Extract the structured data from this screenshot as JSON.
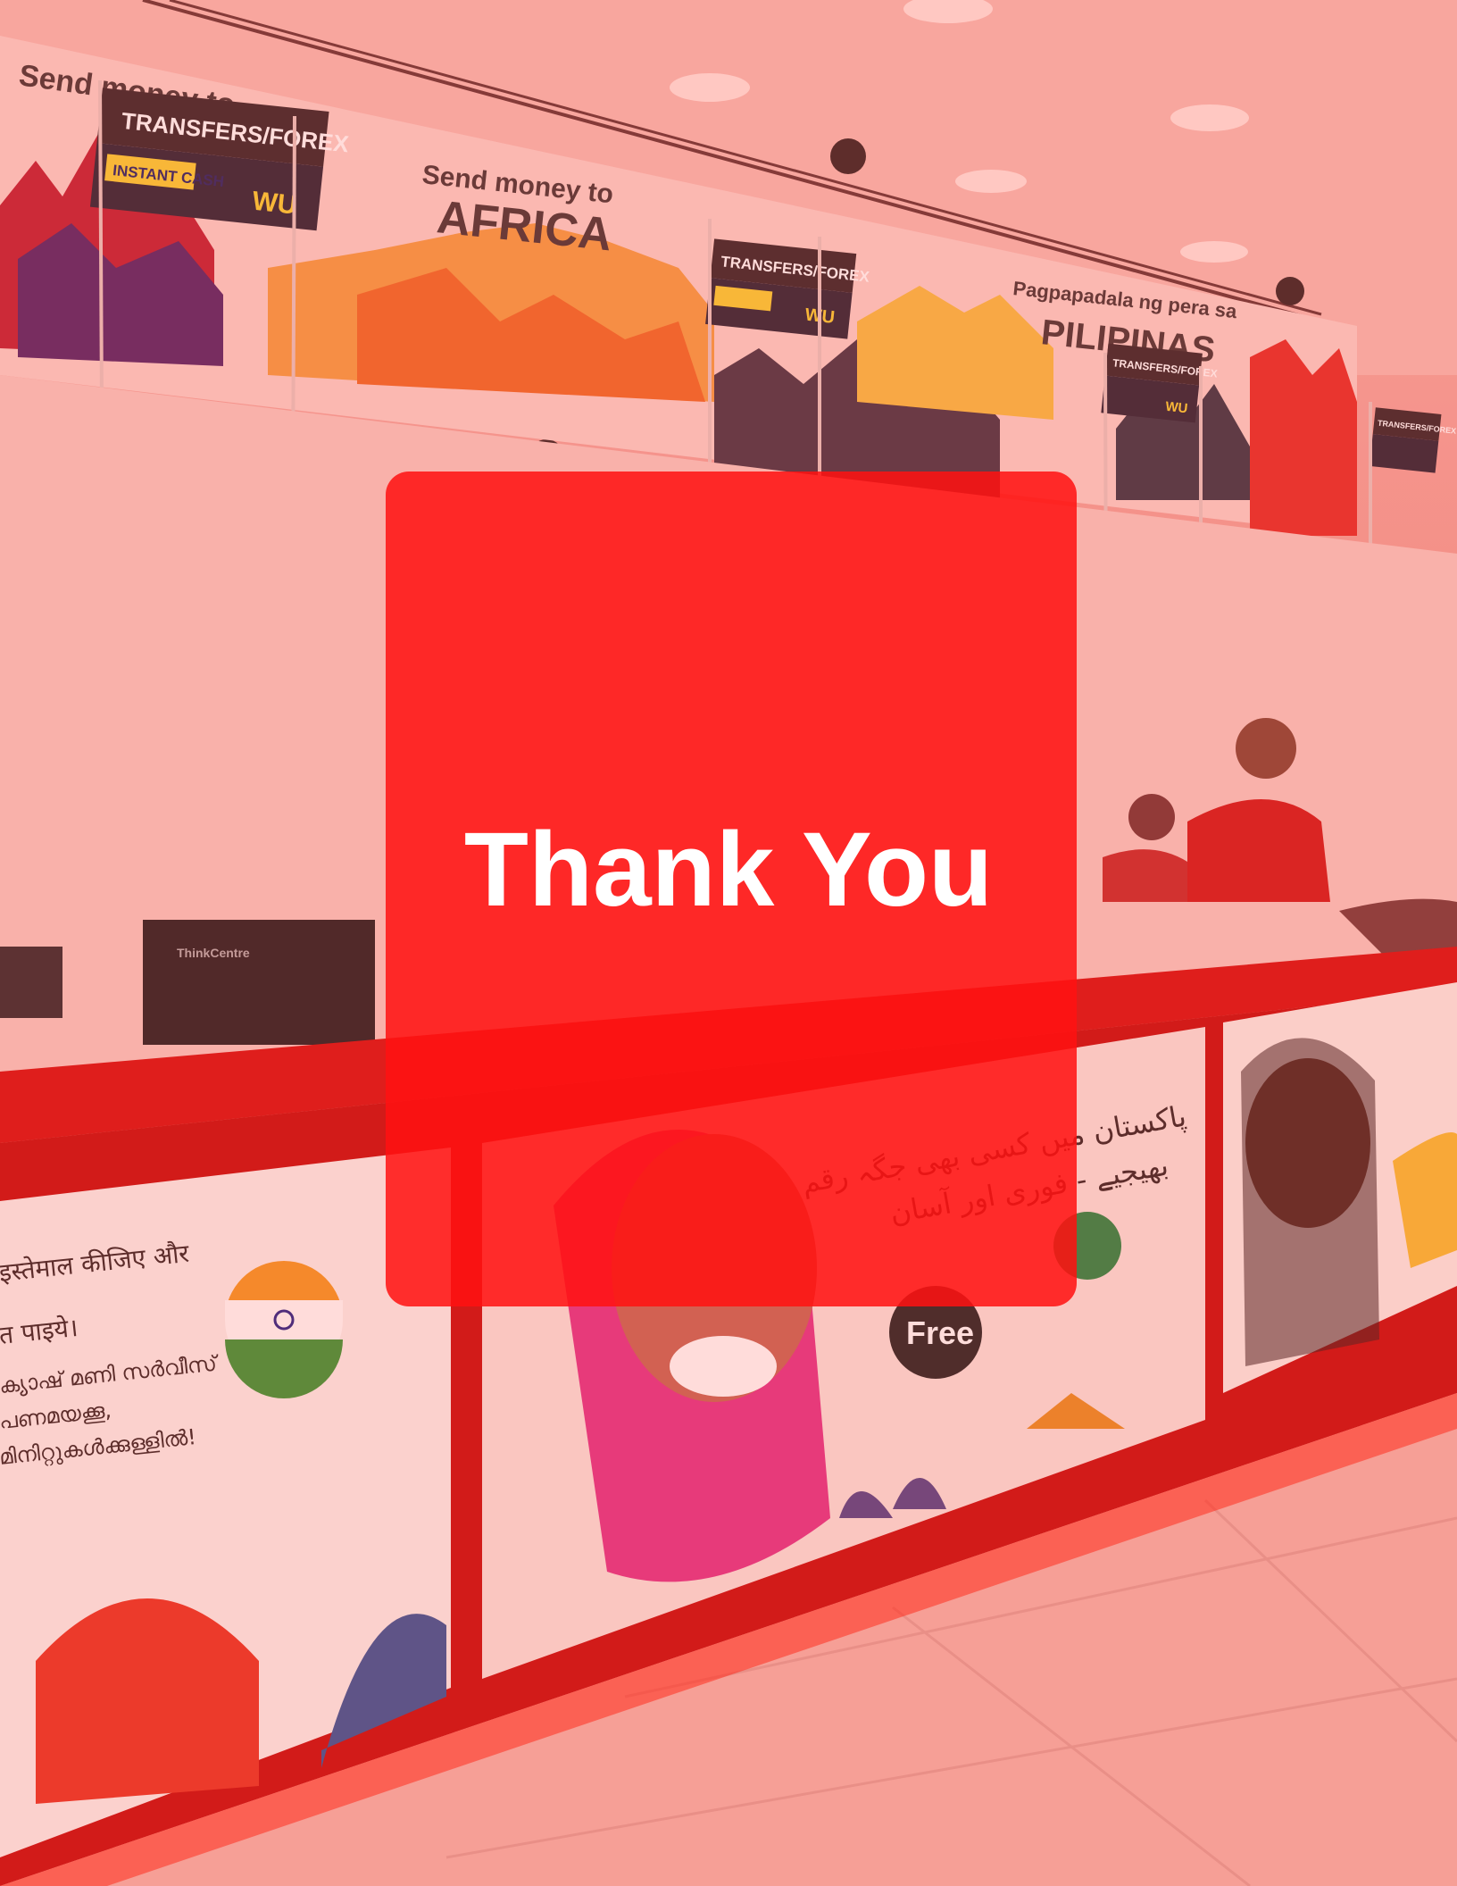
{
  "slide": {
    "title": "Thank You"
  },
  "photo": {
    "signs": {
      "counter_sign": "TRANSFERS/FOREX",
      "instant_cash_logo": "INSTANT CASH",
      "wu_logo": "WU",
      "send_money_africa_line1": "Send money to",
      "send_money_africa_line2": "AFRICA",
      "send_money_left": "Send money to",
      "filipino_line1": "Pagpapadala ng pera sa",
      "filipino_line2": "PILIPINAS",
      "monitor_brand": "ThinkCentre",
      "free_badge": "Free"
    },
    "posters": {
      "hindi_line1": "इस्तेमाल कीजिए और",
      "hindi_line2": "त पाइये।",
      "malayalam_line1": "ക്യാഷ് മണി സർവീസ്",
      "malayalam_line2": "പണമയക്കൂ,",
      "malayalam_line3": "മിനിറ്റുകൾക്കുള്ളിൽ!",
      "urdu_line1": "پاکستان میں کسی بھی جگہ رقم",
      "urdu_line2": "بھیجیے - فوری اور آسان"
    }
  },
  "colors": {
    "card": "#ff1212",
    "title": "#ffffff",
    "counter_red": "#d81818",
    "wash": "#f4a59e"
  }
}
